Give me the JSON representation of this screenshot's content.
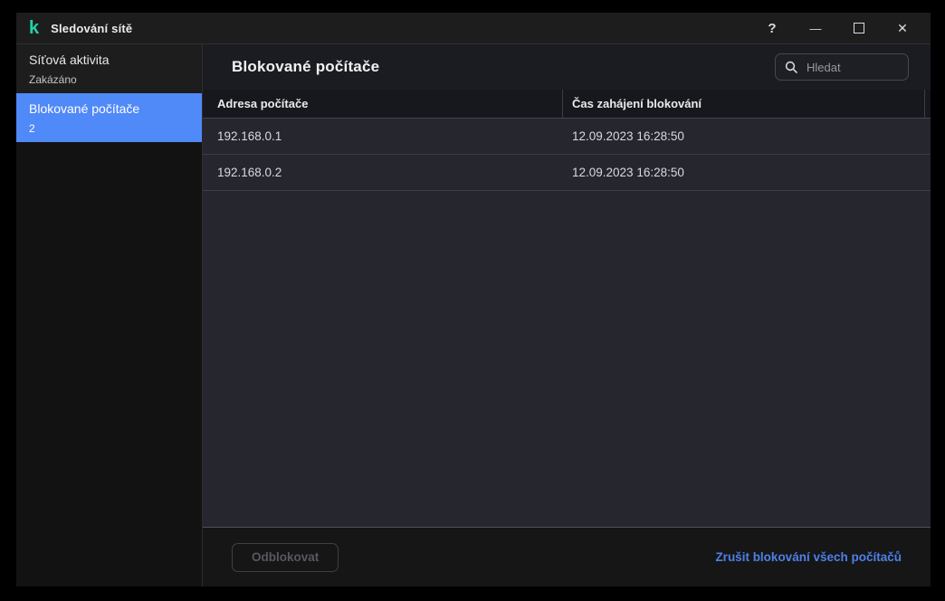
{
  "window": {
    "title": "Sledování sítě",
    "logo_glyph": "k",
    "controls": {
      "help": "?",
      "minimize": "—",
      "close": "✕"
    }
  },
  "sidebar": {
    "items": [
      {
        "label": "Síťová aktivita",
        "sublabel": "Zakázáno",
        "selected": false
      },
      {
        "label": "Blokované počítače",
        "sublabel": "2",
        "selected": true
      }
    ]
  },
  "main": {
    "title": "Blokované počítače",
    "search": {
      "placeholder": "Hledat"
    },
    "table": {
      "columns": [
        "Adresa počítače",
        "Čas zahájení blokování"
      ],
      "rows": [
        {
          "address": "192.168.0.1",
          "time": "12.09.2023 16:28:50"
        },
        {
          "address": "192.168.0.2",
          "time": "12.09.2023 16:28:50"
        }
      ]
    },
    "footer": {
      "unblock_button": "Odblokovat",
      "unblock_all_link": "Zrušit blokování všech počítačů"
    }
  },
  "colors": {
    "accent_selection": "#5089f8",
    "link_blue": "#4d80e8",
    "brand_teal": "#23d1a8",
    "table_body_bg": "#26262e",
    "window_bg": "#1b1c21"
  }
}
